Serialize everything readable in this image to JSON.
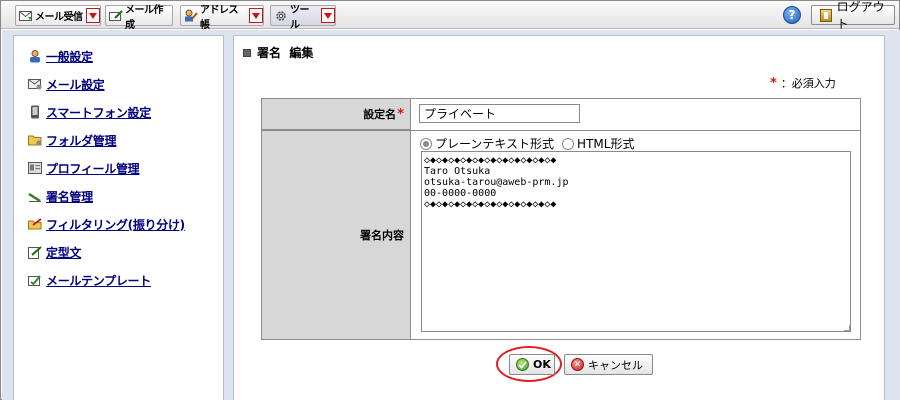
{
  "toolbar": {
    "mail_receive": "メール受信",
    "mail_compose": "メール作成",
    "address_book": "アドレス帳",
    "tools": "ツール",
    "help": "?",
    "logout": "ログアウト"
  },
  "sidebar": {
    "items": [
      {
        "label": "一般設定",
        "icon": "user-icon"
      },
      {
        "label": "メール設定",
        "icon": "mail-settings-icon"
      },
      {
        "label": "スマートフォン設定",
        "icon": "smartphone-icon"
      },
      {
        "label": "フォルダ管理",
        "icon": "folder-icon"
      },
      {
        "label": "プロフィール管理",
        "icon": "profile-icon"
      },
      {
        "label": "署名管理",
        "icon": "pen-icon"
      },
      {
        "label": "フィルタリング(振り分け)",
        "icon": "filter-icon"
      },
      {
        "label": "定型文",
        "icon": "template-text-icon"
      },
      {
        "label": "メールテンプレート",
        "icon": "mail-template-icon"
      }
    ]
  },
  "main": {
    "title": "署名  編集",
    "required_star": "*",
    "required_note": "：必須入力",
    "name_label": "設定名",
    "name_value": "プライベート",
    "content_label": "署名内容",
    "format_plain": "プレーンテキスト形式",
    "format_html": "HTML形式",
    "selected_format": "plain",
    "signature": "◇◆◇◆◇◆◇◆◇◆◇◆◇◆◇◆◇◆◇◆◇◆\nTaro Otsuka\notsuka-tarou@aweb-prm.jp\n00-0000-0000\n◇◆◇◆◇◆◇◆◇◆◇◆◇◆◇◆◇◆◇◆◇◆",
    "ok_label": "OK",
    "cancel_label": "キャンセル"
  },
  "colors": {
    "link": "#000080",
    "required": "#e01010",
    "panel_bg": "#dde4f0",
    "label_bg": "#d7d7d7",
    "highlight_ring": "#e02020"
  }
}
